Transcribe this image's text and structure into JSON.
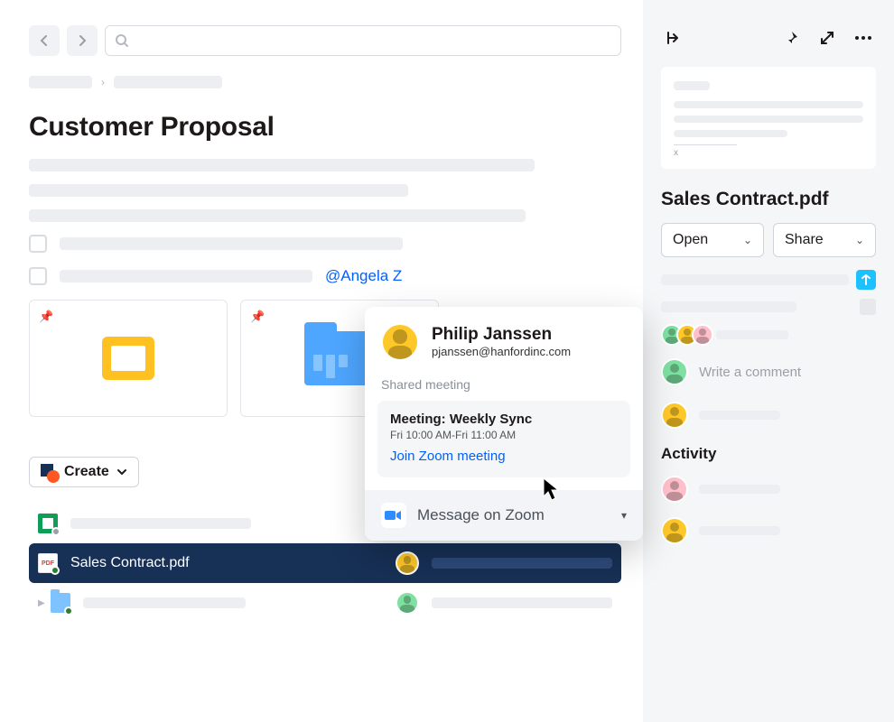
{
  "page": {
    "title": "Customer Proposal",
    "mention": "@Angela Z"
  },
  "popover": {
    "name": "Philip Janssen",
    "email": "pjanssen@hanfordinc.com",
    "shared_label": "Shared meeting",
    "meeting_title": "Meeting: Weekly Sync",
    "meeting_time": "Fri 10:00 AM-Fri 11:00 AM",
    "join_label": "Join Zoom meeting",
    "message_label": "Message on Zoom"
  },
  "create_button": "Create",
  "files": {
    "selected": "Sales Contract.pdf",
    "pdf_badge": "PDF"
  },
  "side": {
    "file_title": "Sales Contract.pdf",
    "open_label": "Open",
    "share_label": "Share",
    "comment_placeholder": "Write a comment",
    "activity_heading": "Activity",
    "signature_x": "x"
  }
}
